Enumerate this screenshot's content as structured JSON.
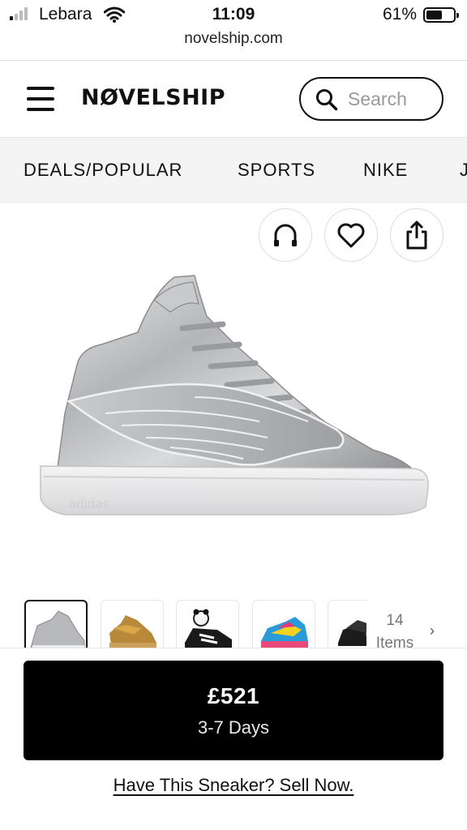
{
  "status_bar": {
    "carrier": "Lebara",
    "time": "11:09",
    "battery_percent": "61%",
    "battery_level": 0.61,
    "signal_bars_active": 1,
    "signal_bars_total": 4
  },
  "browser": {
    "url": "novelship.com"
  },
  "header": {
    "logo": "NØVELSHIP",
    "search_placeholder": "Search"
  },
  "categories": [
    "DEALS/POPULAR",
    "SPORTS",
    "NIKE",
    "J"
  ],
  "actions": {
    "first_icon": "headphones-icon",
    "second_icon": "heart-icon",
    "third_icon": "share-icon"
  },
  "product": {
    "image_icon": "silver-winged-sneaker",
    "brand_mark": "adidas"
  },
  "thumbnails": {
    "items": [
      "silver",
      "gold",
      "panda",
      "multicolor",
      "black"
    ],
    "more_count": "14",
    "more_label": "Items"
  },
  "buy": {
    "price": "£521",
    "delivery": "3-7 Days"
  },
  "sell_link": "Have This Sneaker? Sell Now.",
  "colors": {
    "primary": "#000000",
    "nav_bg": "#f4f4f4"
  }
}
